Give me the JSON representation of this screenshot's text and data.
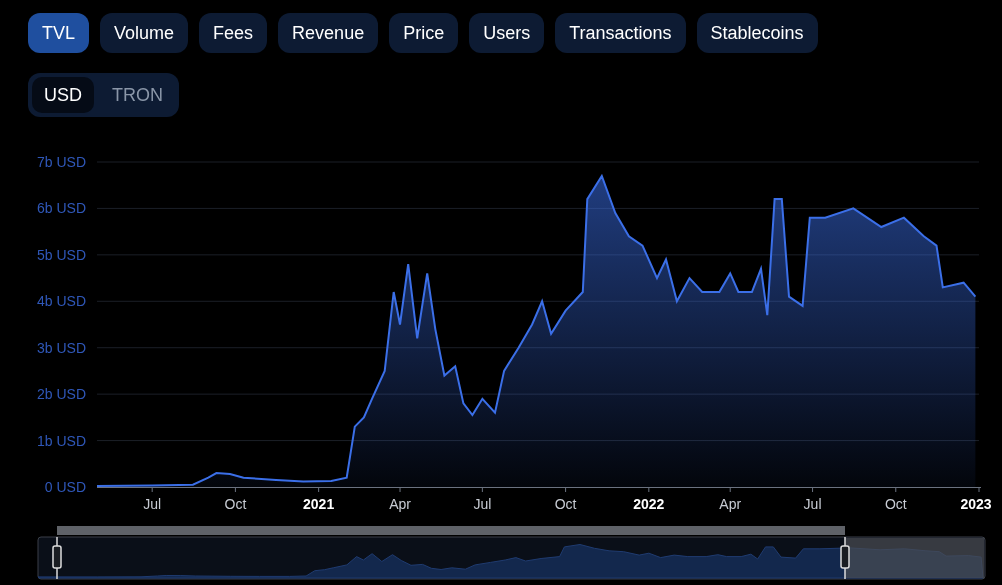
{
  "metric_tabs": [
    {
      "label": "TVL",
      "selected": true
    },
    {
      "label": "Volume",
      "selected": false
    },
    {
      "label": "Fees",
      "selected": false
    },
    {
      "label": "Revenue",
      "selected": false
    },
    {
      "label": "Price",
      "selected": false
    },
    {
      "label": "Users",
      "selected": false
    },
    {
      "label": "Transactions",
      "selected": false
    },
    {
      "label": "Stablecoins",
      "selected": false
    }
  ],
  "denomination": [
    {
      "label": "USD",
      "selected": true
    },
    {
      "label": "TRON",
      "selected": false
    }
  ],
  "chart": {
    "chart_data": {
      "type": "area",
      "x": [
        "2020-05-01",
        "2020-07-01",
        "2020-08-15",
        "2020-09-01",
        "2020-09-10",
        "2020-09-25",
        "2020-10-10",
        "2020-11-15",
        "2020-12-15",
        "2021-01-15",
        "2021-02-01",
        "2021-02-10",
        "2021-02-20",
        "2021-03-01",
        "2021-03-15",
        "2021-03-25",
        "2021-04-01",
        "2021-04-10",
        "2021-04-20",
        "2021-05-01",
        "2021-05-10",
        "2021-05-20",
        "2021-06-01",
        "2021-06-10",
        "2021-06-20",
        "2021-07-01",
        "2021-07-15",
        "2021-07-25",
        "2021-08-10",
        "2021-08-25",
        "2021-09-05",
        "2021-09-15",
        "2021-10-01",
        "2021-10-20",
        "2021-10-25",
        "2021-11-10",
        "2021-11-25",
        "2021-12-10",
        "2021-12-25",
        "2022-01-10",
        "2022-01-20",
        "2022-02-01",
        "2022-02-15",
        "2022-03-01",
        "2022-03-20",
        "2022-04-01",
        "2022-04-10",
        "2022-04-25",
        "2022-05-05",
        "2022-05-12",
        "2022-05-20",
        "2022-05-28",
        "2022-06-05",
        "2022-06-20",
        "2022-06-28",
        "2022-07-15",
        "2022-08-15",
        "2022-09-15",
        "2022-10-10",
        "2022-11-01",
        "2022-11-15",
        "2022-11-22",
        "2022-12-15",
        "2022-12-28"
      ],
      "grid": true,
      "series": [
        {
          "color": "#3b6fe8",
          "values": [
            0.02,
            0.03,
            0.05,
            0.2,
            0.3,
            0.28,
            0.2,
            0.15,
            0.12,
            0.13,
            0.2,
            1.3,
            1.5,
            1.9,
            2.5,
            4.2,
            3.5,
            4.8,
            3.2,
            4.6,
            3.4,
            2.4,
            2.6,
            1.8,
            1.55,
            1.9,
            1.6,
            2.5,
            3.0,
            3.5,
            4.0,
            3.3,
            3.8,
            4.2,
            6.2,
            6.7,
            5.9,
            5.4,
            5.2,
            4.5,
            4.9,
            4.0,
            4.5,
            4.2,
            4.2,
            4.6,
            4.2,
            4.2,
            4.7,
            3.7,
            6.2,
            6.2,
            4.1,
            3.9,
            5.8,
            5.8,
            6.0,
            5.6,
            5.8,
            5.4,
            5.2,
            4.3,
            4.4,
            4.1
          ]
        }
      ],
      "xlim": [
        "2020-05-01",
        "2023-01-01"
      ],
      "ylim": [
        0,
        7
      ],
      "xticks": [
        {
          "value": "2020-07-01",
          "label": "Jul"
        },
        {
          "value": "2020-10-01",
          "label": "Oct"
        },
        {
          "value": "2021-01-01",
          "label": "2021"
        },
        {
          "value": "2021-04-01",
          "label": "Apr"
        },
        {
          "value": "2021-07-01",
          "label": "Jul"
        },
        {
          "value": "2021-10-01",
          "label": "Oct"
        },
        {
          "value": "2022-01-01",
          "label": "2022"
        },
        {
          "value": "2022-04-01",
          "label": "Apr"
        },
        {
          "value": "2022-07-01",
          "label": "Jul"
        },
        {
          "value": "2022-10-01",
          "label": "Oct"
        },
        {
          "value": "2023-01-01",
          "label": "2023"
        }
      ],
      "yticks": [
        {
          "value": 0,
          "label": "0 USD"
        },
        {
          "value": 1,
          "label": "1b USD"
        },
        {
          "value": 2,
          "label": "2b USD"
        },
        {
          "value": 3,
          "label": "3b USD"
        },
        {
          "value": 4,
          "label": "4b USD"
        },
        {
          "value": 5,
          "label": "5b USD"
        },
        {
          "value": 6,
          "label": "6b USD"
        },
        {
          "value": 7,
          "label": "7b USD"
        }
      ]
    }
  }
}
